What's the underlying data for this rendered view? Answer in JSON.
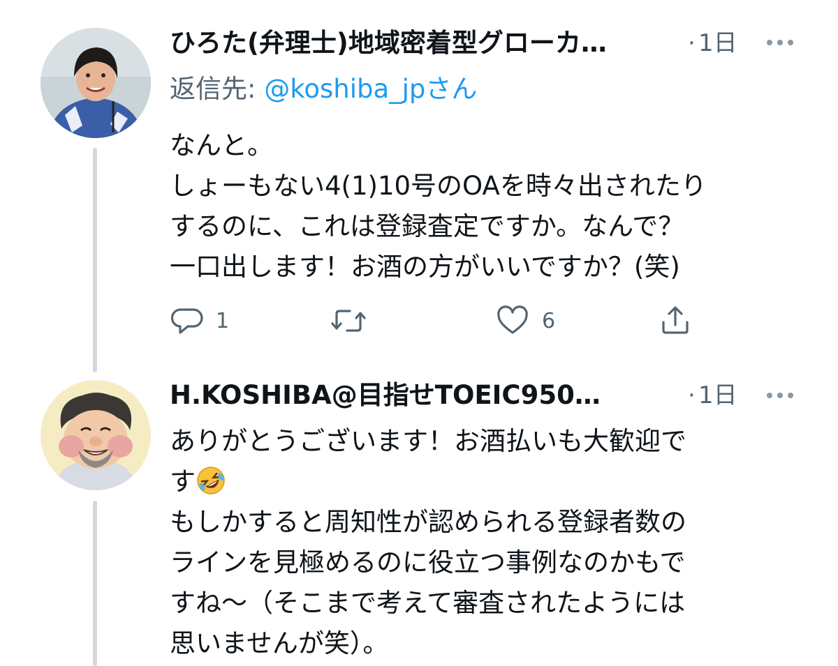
{
  "tweets": [
    {
      "author": "ひろた(弁理士)地域密着型グローカ…",
      "separator": "·",
      "time": "1日",
      "reply_to_label": "返信先: ",
      "reply_to_handle": "@koshiba_jp",
      "reply_to_suffix": "さん",
      "lines": [
        "なんと。",
        "しょーもない4(1)10号のOAを時々出されたり",
        "するのに、これは登録査定ですか。なんで？",
        "一口出します！お酒の方がいいですか？(笑)"
      ],
      "actions": {
        "reply_count": "1",
        "retweet_count": "",
        "like_count": "6"
      },
      "colors": {
        "avatar_bg": "#b9c7cf",
        "shirt": "#3a5fa8"
      }
    },
    {
      "author": "H.KOSHIBA@目指せTOEIC950…",
      "separator": "·",
      "time": "1日",
      "lines": [
        "ありがとうございます！お酒払いも大歓迎で",
        "す",
        "もしかすると周知性が認められる登録者数の",
        "ラインを見極めるのに役立つ事例なのかもで",
        "すね～（そこまで考えて審査されたようには",
        "思いませんが笑）。"
      ],
      "emoji": "rolling-on-floor-laughing",
      "colors": {
        "avatar_bg": "#f3e7b8"
      }
    }
  ],
  "icons": {
    "reply": "speech-bubble-icon",
    "retweet": "retweet-arrows-icon",
    "like": "heart-icon",
    "share": "share-upload-icon",
    "more": "more-dots-icon"
  }
}
